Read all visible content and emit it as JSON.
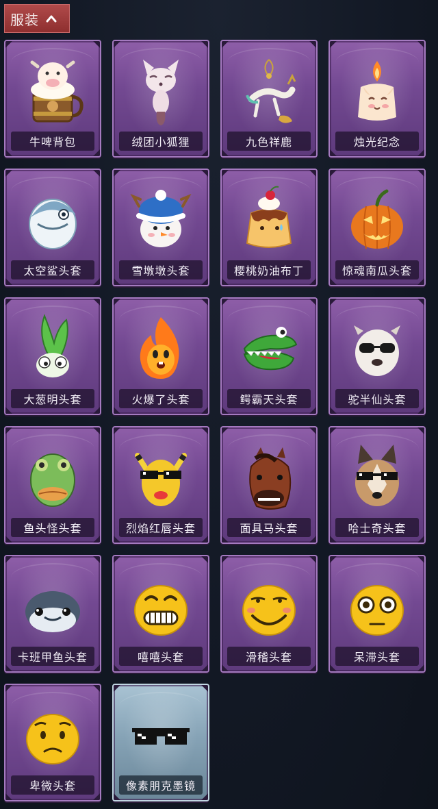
{
  "category": {
    "title": "服装",
    "toggle_icon": "chevron-up-icon",
    "accent_color": "#a03b3b"
  },
  "items": [
    {
      "name": "牛啤背包",
      "icon": "cow-beer-mug-icon",
      "rarity_color": "#7a4e98"
    },
    {
      "name": "绒团小狐狸",
      "icon": "fox-plush-icon",
      "rarity_color": "#7a4e98"
    },
    {
      "name": "九色祥鹿",
      "icon": "deer-ornament-icon",
      "rarity_color": "#7a4e98"
    },
    {
      "name": "烛光纪念",
      "icon": "candle-icon",
      "rarity_color": "#7a4e98"
    },
    {
      "name": "太空鲨头套",
      "icon": "shark-helmet-icon",
      "rarity_color": "#7a4e98"
    },
    {
      "name": "雪墩墩头套",
      "icon": "snowman-helmet-icon",
      "rarity_color": "#7a4e98"
    },
    {
      "name": "樱桃奶油布丁",
      "icon": "pudding-icon",
      "rarity_color": "#7a4e98"
    },
    {
      "name": "惊魂南瓜头套",
      "icon": "pumpkin-helmet-icon",
      "rarity_color": "#7a4e98"
    },
    {
      "name": "大葱明头套",
      "icon": "scallion-helmet-icon",
      "rarity_color": "#7a4e98"
    },
    {
      "name": "火爆了头套",
      "icon": "fire-helmet-icon",
      "rarity_color": "#7a4e98"
    },
    {
      "name": "鳄霸天头套",
      "icon": "crocodile-helmet-icon",
      "rarity_color": "#7a4e98"
    },
    {
      "name": "驼半仙头套",
      "icon": "alpaca-helmet-icon",
      "rarity_color": "#7a4e98"
    },
    {
      "name": "鱼头怪头套",
      "icon": "fish-mask-icon",
      "rarity_color": "#7a4e98"
    },
    {
      "name": "烈焰红唇头套",
      "icon": "yellow-mask-icon",
      "rarity_color": "#7a4e98"
    },
    {
      "name": "面具马头套",
      "icon": "horse-mask-icon",
      "rarity_color": "#7a4e98"
    },
    {
      "name": "哈士奇头套",
      "icon": "husky-mask-icon",
      "rarity_color": "#7a4e98"
    },
    {
      "name": "卡班甲鱼头套",
      "icon": "whale-helmet-icon",
      "rarity_color": "#7a4e98"
    },
    {
      "name": "嘻嘻头套",
      "icon": "grin-emoji-icon",
      "rarity_color": "#7a4e98"
    },
    {
      "name": "滑稽头套",
      "icon": "smirk-emoji-icon",
      "rarity_color": "#7a4e98"
    },
    {
      "name": "呆滞头套",
      "icon": "stare-emoji-icon",
      "rarity_color": "#7a4e98"
    },
    {
      "name": "卑微头套",
      "icon": "humble-emoji-icon",
      "rarity_color": "#7a4e98"
    },
    {
      "name": "像素朋克墨镜",
      "icon": "pixel-sunglasses-icon",
      "rarity_color": "#8aa5b8"
    }
  ]
}
